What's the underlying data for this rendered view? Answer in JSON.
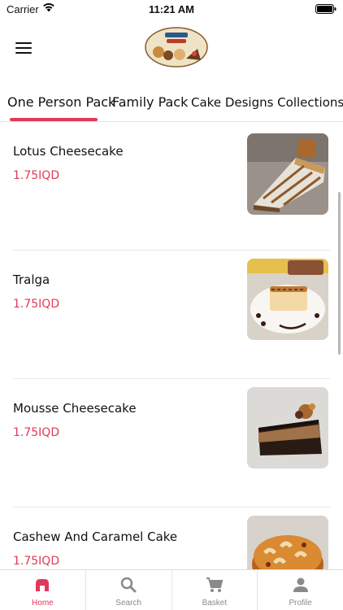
{
  "status_bar": {
    "carrier": "Carrier",
    "time": "11:21 AM"
  },
  "header": {
    "logo_icon": "bakery-logo-icon",
    "menu_icon": "hamburger-menu-icon"
  },
  "tabs": [
    {
      "label": "One Person Pack",
      "active": true
    },
    {
      "label": "Family Pack",
      "active": false
    },
    {
      "label": "Cake Designs Collections",
      "active": false
    }
  ],
  "products": [
    {
      "name": "Lotus Cheesecake",
      "price": "1.75IQD",
      "image": "lotus-cheesecake-photo"
    },
    {
      "name": "Tralga",
      "price": "1.75IQD",
      "image": "tralga-photo"
    },
    {
      "name": "Mousse Cheesecake",
      "price": "1.75IQD",
      "image": "mousse-cheesecake-photo"
    },
    {
      "name": "Cashew And Caramel Cake",
      "price": "1.75IQD",
      "image": "cashew-caramel-cake-photo"
    }
  ],
  "bottom_nav": [
    {
      "label": "Home",
      "icon": "home-icon",
      "active": true
    },
    {
      "label": "Search",
      "icon": "search-icon",
      "active": false
    },
    {
      "label": "Basket",
      "icon": "basket-icon",
      "active": false
    },
    {
      "label": "Profile",
      "icon": "profile-icon",
      "active": false
    }
  ],
  "colors": {
    "accent": "#e0395a",
    "inactive": "#8a8a8a",
    "divider": "#e8e8e8"
  }
}
